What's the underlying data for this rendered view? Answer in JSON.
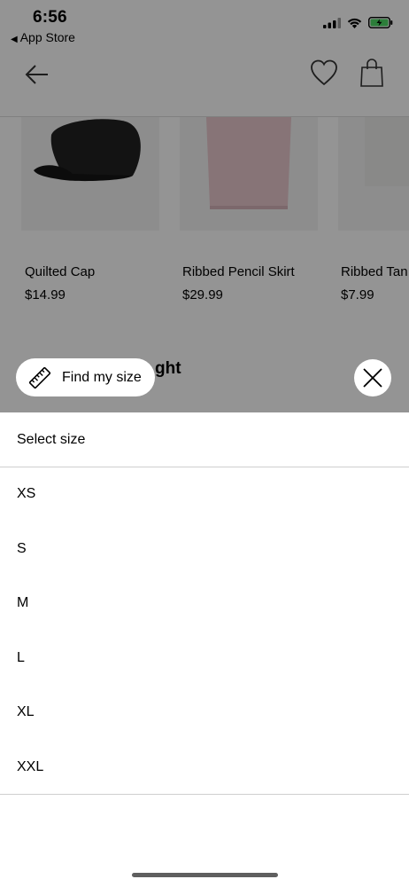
{
  "status_bar": {
    "time": "6:56",
    "back_app_label": "App Store",
    "battery_color": "#4cd964"
  },
  "nav": {
    "back_icon": "arrow-left-icon",
    "wishlist_icon": "heart-icon",
    "bag_icon": "shopping-bag-icon"
  },
  "products": [
    {
      "name": "Quilted Cap",
      "price": "$14.99"
    },
    {
      "name": "Ribbed Pencil Skirt",
      "price": "$29.99"
    },
    {
      "name": "Ribbed Tan",
      "price": "$7.99"
    }
  ],
  "section_title_partial": "ght",
  "find_my_size": {
    "label": "Find my size",
    "icon": "ruler-icon"
  },
  "size_sheet": {
    "title": "Select size",
    "options": [
      "XS",
      "S",
      "M",
      "L",
      "XL",
      "XXL"
    ]
  },
  "colors": {
    "overlay": "rgba(0,0,0,0.42)",
    "sheet_background": "#ffffff"
  }
}
